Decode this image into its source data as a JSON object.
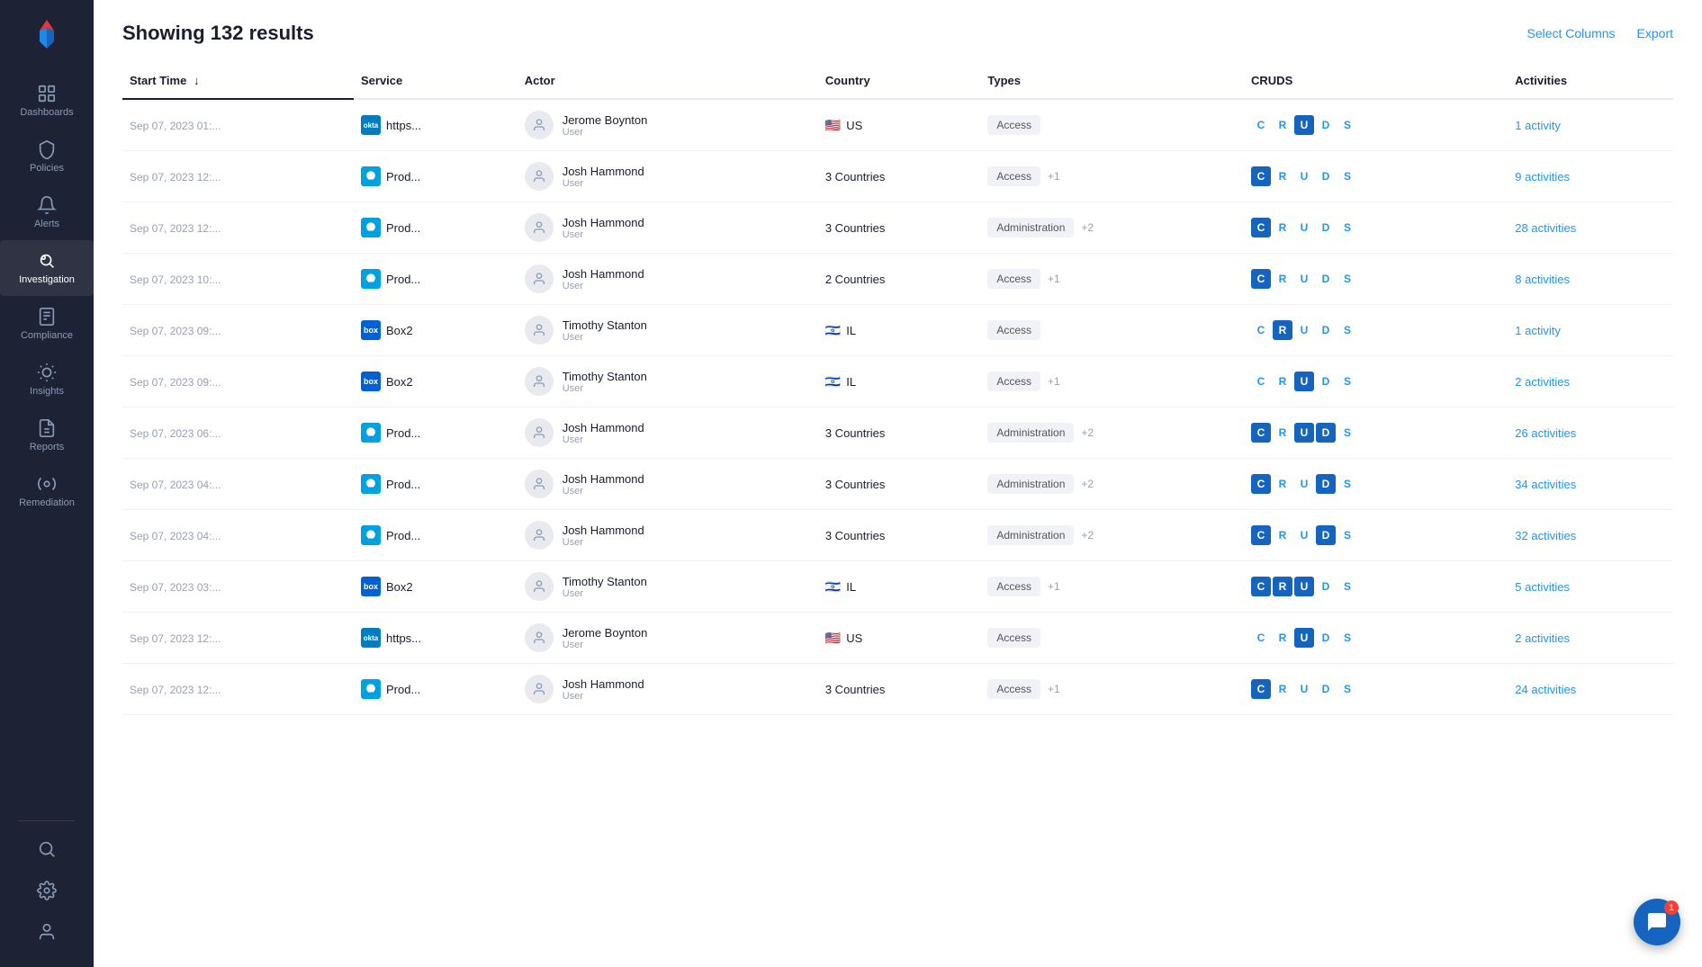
{
  "sidebar": {
    "items": [
      {
        "label": "Dashboards",
        "icon": "dashboards-icon",
        "active": false
      },
      {
        "label": "Policies",
        "icon": "policies-icon",
        "active": false
      },
      {
        "label": "Alerts",
        "icon": "alerts-icon",
        "active": false
      },
      {
        "label": "Investigation",
        "icon": "investigation-icon",
        "active": true
      },
      {
        "label": "Compliance",
        "icon": "compliance-icon",
        "active": false
      },
      {
        "label": "Insights",
        "icon": "insights-icon",
        "active": false
      },
      {
        "label": "Reports",
        "icon": "reports-icon",
        "active": false
      },
      {
        "label": "Remediation",
        "icon": "remediation-icon",
        "active": false
      }
    ],
    "bottom_items": [
      {
        "label": "",
        "icon": "search-icon"
      },
      {
        "label": "",
        "icon": "settings-icon"
      },
      {
        "label": "",
        "icon": "user-icon"
      }
    ]
  },
  "header": {
    "title": "Showing 132 results",
    "select_columns_label": "Select Columns",
    "export_label": "Export"
  },
  "table": {
    "columns": [
      {
        "key": "start_time",
        "label": "Start Time",
        "sorted": true
      },
      {
        "key": "service",
        "label": "Service",
        "sorted": false
      },
      {
        "key": "actor",
        "label": "Actor",
        "sorted": false
      },
      {
        "key": "country",
        "label": "Country",
        "sorted": false
      },
      {
        "key": "types",
        "label": "Types",
        "sorted": false
      },
      {
        "key": "cruds",
        "label": "CRUDS",
        "sorted": false
      },
      {
        "key": "activities",
        "label": "Activities",
        "sorted": false
      }
    ],
    "rows": [
      {
        "start_time": "Sep 07, 2023 01:...",
        "service_type": "okta",
        "service_label": "https...",
        "actor_name": "Jerome Boynton",
        "actor_role": "User",
        "country_flag": "🇺🇸",
        "country": "US",
        "type": "Access",
        "type_extra": "",
        "cruds": [
          "C",
          "R",
          "U",
          "D",
          "S"
        ],
        "cruds_active": [
          2
        ],
        "activities": "1 activity"
      },
      {
        "start_time": "Sep 07, 2023 12:...",
        "service_type": "salesforce",
        "service_label": "Prod...",
        "actor_name": "Josh Hammond",
        "actor_role": "User",
        "country_flag": "",
        "country": "3 Countries",
        "type": "Access",
        "type_extra": "+1",
        "cruds": [
          "C",
          "R",
          "U",
          "D",
          "S"
        ],
        "cruds_active": [
          0
        ],
        "activities": "9 activities"
      },
      {
        "start_time": "Sep 07, 2023 12:...",
        "service_type": "salesforce",
        "service_label": "Prod...",
        "actor_name": "Josh Hammond",
        "actor_role": "User",
        "country_flag": "",
        "country": "3 Countries",
        "type": "Administration",
        "type_extra": "+2",
        "cruds": [
          "C",
          "R",
          "U",
          "D",
          "S"
        ],
        "cruds_active": [
          0
        ],
        "activities": "28 activities"
      },
      {
        "start_time": "Sep 07, 2023 10:...",
        "service_type": "salesforce",
        "service_label": "Prod...",
        "actor_name": "Josh Hammond",
        "actor_role": "User",
        "country_flag": "",
        "country": "2 Countries",
        "type": "Access",
        "type_extra": "+1",
        "cruds": [
          "C",
          "R",
          "U",
          "D",
          "S"
        ],
        "cruds_active": [
          0
        ],
        "activities": "8 activities"
      },
      {
        "start_time": "Sep 07, 2023 09:...",
        "service_type": "box",
        "service_label": "Box2",
        "actor_name": "Timothy Stanton",
        "actor_role": "User",
        "country_flag": "🇮🇱",
        "country": "IL",
        "type": "Access",
        "type_extra": "",
        "cruds": [
          "C",
          "R",
          "U",
          "D",
          "S"
        ],
        "cruds_active": [
          1
        ],
        "activities": "1 activity"
      },
      {
        "start_time": "Sep 07, 2023 09:...",
        "service_type": "box",
        "service_label": "Box2",
        "actor_name": "Timothy Stanton",
        "actor_role": "User",
        "country_flag": "🇮🇱",
        "country": "IL",
        "type": "Access",
        "type_extra": "+1",
        "cruds": [
          "C",
          "R",
          "U",
          "D",
          "S"
        ],
        "cruds_active": [
          2
        ],
        "activities": "2 activities"
      },
      {
        "start_time": "Sep 07, 2023 06:...",
        "service_type": "salesforce",
        "service_label": "Prod...",
        "actor_name": "Josh Hammond",
        "actor_role": "User",
        "country_flag": "",
        "country": "3 Countries",
        "type": "Administration",
        "type_extra": "+2",
        "cruds": [
          "C",
          "R",
          "U",
          "D",
          "S"
        ],
        "cruds_active": [
          0,
          2,
          3
        ],
        "activities": "26 activities"
      },
      {
        "start_time": "Sep 07, 2023 04:...",
        "service_type": "salesforce",
        "service_label": "Prod...",
        "actor_name": "Josh Hammond",
        "actor_role": "User",
        "country_flag": "",
        "country": "3 Countries",
        "type": "Administration",
        "type_extra": "+2",
        "cruds": [
          "C",
          "R",
          "U",
          "D",
          "S"
        ],
        "cruds_active": [
          0,
          3
        ],
        "activities": "34 activities"
      },
      {
        "start_time": "Sep 07, 2023 04:...",
        "service_type": "salesforce",
        "service_label": "Prod...",
        "actor_name": "Josh Hammond",
        "actor_role": "User",
        "country_flag": "",
        "country": "3 Countries",
        "type": "Administration",
        "type_extra": "+2",
        "cruds": [
          "C",
          "R",
          "U",
          "D",
          "S"
        ],
        "cruds_active": [
          0,
          3
        ],
        "activities": "32 activities"
      },
      {
        "start_time": "Sep 07, 2023 03:...",
        "service_type": "box",
        "service_label": "Box2",
        "actor_name": "Timothy Stanton",
        "actor_role": "User",
        "country_flag": "🇮🇱",
        "country": "IL",
        "type": "Access",
        "type_extra": "+1",
        "cruds": [
          "C",
          "R",
          "U",
          "D",
          "S"
        ],
        "cruds_active": [
          0,
          1,
          2
        ],
        "activities": "5 activities"
      },
      {
        "start_time": "Sep 07, 2023 12:...",
        "service_type": "okta",
        "service_label": "https...",
        "actor_name": "Jerome Boynton",
        "actor_role": "User",
        "country_flag": "🇺🇸",
        "country": "US",
        "type": "Access",
        "type_extra": "",
        "cruds": [
          "C",
          "R",
          "U",
          "D",
          "S"
        ],
        "cruds_active": [
          2
        ],
        "activities": "2 activities"
      },
      {
        "start_time": "Sep 07, 2023 12:...",
        "service_type": "salesforce",
        "service_label": "Prod...",
        "actor_name": "Josh Hammond",
        "actor_role": "User",
        "country_flag": "",
        "country": "3 Countries",
        "type": "Access",
        "type_extra": "+1",
        "cruds": [
          "C",
          "R",
          "U",
          "D",
          "S"
        ],
        "cruds_active": [
          0
        ],
        "activities": "24 activities"
      }
    ]
  },
  "chat": {
    "badge": "1"
  }
}
